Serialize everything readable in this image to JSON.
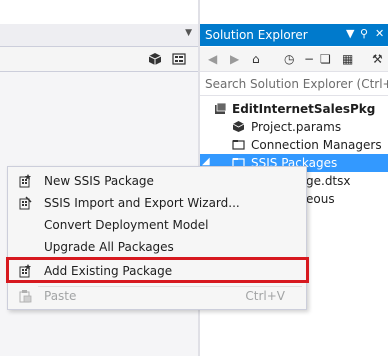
{
  "editor": {
    "dropdown_icon": "dropdown-arrow-icon",
    "toolbar_icons": [
      "package-icon",
      "variables-icon"
    ]
  },
  "solution_explorer": {
    "title": "Solution Explorer",
    "header_icons": [
      "dropdown-icon",
      "pin-icon",
      "close-icon"
    ],
    "toolbar_icons": [
      "back-icon",
      "forward-icon",
      "home-icon",
      "history-icon",
      "collapse-all-icon",
      "copy-icon",
      "properties-icon",
      "wrench-icon"
    ],
    "search_placeholder": "Search Solution Explorer (Ctrl+;)",
    "tree": [
      {
        "label": "EditInternetSalesPkg",
        "bold": true,
        "icon": "project-icon"
      },
      {
        "label": "Project.params",
        "icon": "params-icon"
      },
      {
        "label": "Connection Managers",
        "icon": "folder-icon"
      },
      {
        "label": "SSIS Packages",
        "icon": "folder-icon",
        "selected": true,
        "expanded": true
      },
      {
        "label": "ge.dtsx",
        "icon": "package-file-icon"
      },
      {
        "label": "eous",
        "icon": "folder-icon"
      }
    ]
  },
  "context_menu": {
    "items": [
      {
        "label": "New SSIS Package",
        "icon": "new-package-icon"
      },
      {
        "label": "SSIS Import and Export Wizard...",
        "icon": "wizard-icon"
      },
      {
        "label": "Convert Deployment Model",
        "icon": ""
      },
      {
        "label": "Upgrade All Packages",
        "icon": ""
      },
      {
        "label": "Add Existing Package",
        "icon": "add-package-icon",
        "highlighted": true
      },
      {
        "label": "Paste",
        "icon": "paste-icon",
        "shortcut": "Ctrl+V",
        "disabled": true
      }
    ]
  },
  "colors": {
    "accent": "#007acc",
    "selection": "#3399ff",
    "highlight_border": "#d7191f"
  }
}
